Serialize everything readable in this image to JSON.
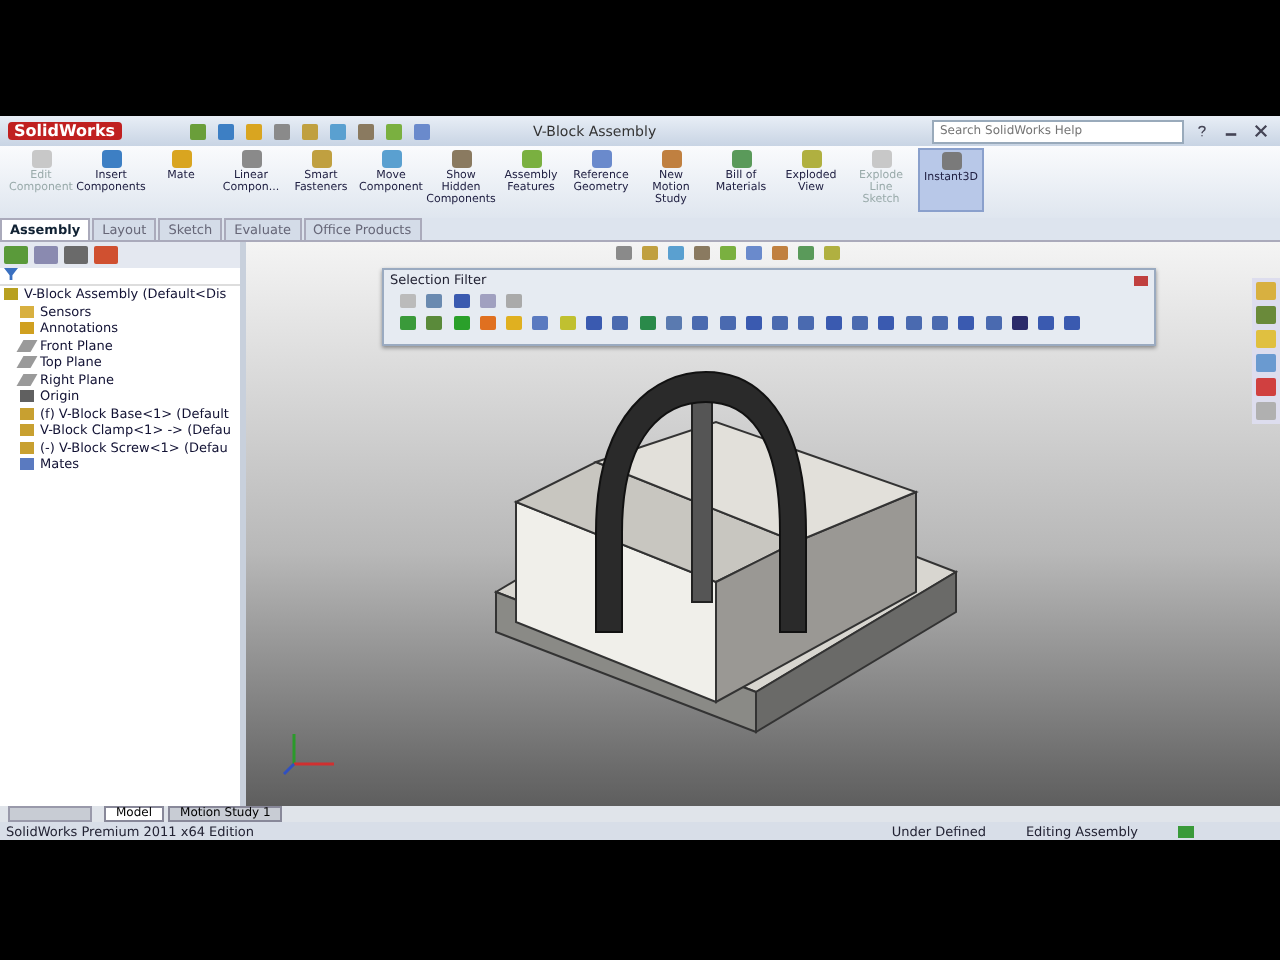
{
  "title_bar": {
    "app_name": "SolidWorks",
    "document_title": "V-Block Assembly",
    "search_placeholder": "Search SolidWorks Help"
  },
  "ribbon": {
    "buttons": [
      {
        "label": "Edit Component",
        "disabled": true,
        "on": false
      },
      {
        "label": "Insert Components",
        "disabled": false,
        "on": false
      },
      {
        "label": "Mate",
        "disabled": false,
        "on": false
      },
      {
        "label": "Linear Compon...",
        "disabled": false,
        "on": false
      },
      {
        "label": "Smart Fasteners",
        "disabled": false,
        "on": false
      },
      {
        "label": "Move Component",
        "disabled": false,
        "on": false
      },
      {
        "label": "Show Hidden Components",
        "disabled": false,
        "on": false
      },
      {
        "label": "Assembly Features",
        "disabled": false,
        "on": false
      },
      {
        "label": "Reference Geometry",
        "disabled": false,
        "on": false
      },
      {
        "label": "New Motion Study",
        "disabled": false,
        "on": false
      },
      {
        "label": "Bill of Materials",
        "disabled": false,
        "on": false
      },
      {
        "label": "Exploded View",
        "disabled": false,
        "on": false
      },
      {
        "label": "Explode Line Sketch",
        "disabled": true,
        "on": false
      },
      {
        "label": "Instant3D",
        "disabled": false,
        "on": true
      }
    ]
  },
  "tabs": [
    {
      "label": "Assembly",
      "selected": true
    },
    {
      "label": "Layout",
      "selected": false
    },
    {
      "label": "Sketch",
      "selected": false
    },
    {
      "label": "Evaluate",
      "selected": false
    },
    {
      "label": "Office Products",
      "selected": false
    }
  ],
  "feature_tree": {
    "items": [
      {
        "label": "V-Block Assembly  (Default<Dis",
        "kind": "assembly",
        "children": [
          {
            "label": "Sensors",
            "kind": "folder"
          },
          {
            "label": "Annotations",
            "kind": "annotation"
          },
          {
            "label": "Front Plane",
            "kind": "plane"
          },
          {
            "label": "Top Plane",
            "kind": "plane"
          },
          {
            "label": "Right Plane",
            "kind": "plane"
          },
          {
            "label": "Origin",
            "kind": "origin"
          },
          {
            "label": "(f) V-Block Base<1> (Default",
            "kind": "part"
          },
          {
            "label": "V-Block Clamp<1> -> (Defau",
            "kind": "part"
          },
          {
            "label": "(-) V-Block Screw<1> (Defau",
            "kind": "part"
          },
          {
            "label": "Mates",
            "kind": "mates"
          }
        ]
      }
    ]
  },
  "selection_filter": {
    "title": "Selection Filter"
  },
  "bottom_tabs": [
    {
      "label": "Model",
      "selected": true
    },
    {
      "label": "Motion Study 1",
      "selected": false
    }
  ],
  "status_bar": {
    "edition": "SolidWorks Premium 2011 x64 Edition",
    "state": "Under Defined",
    "mode": "Editing Assembly"
  }
}
